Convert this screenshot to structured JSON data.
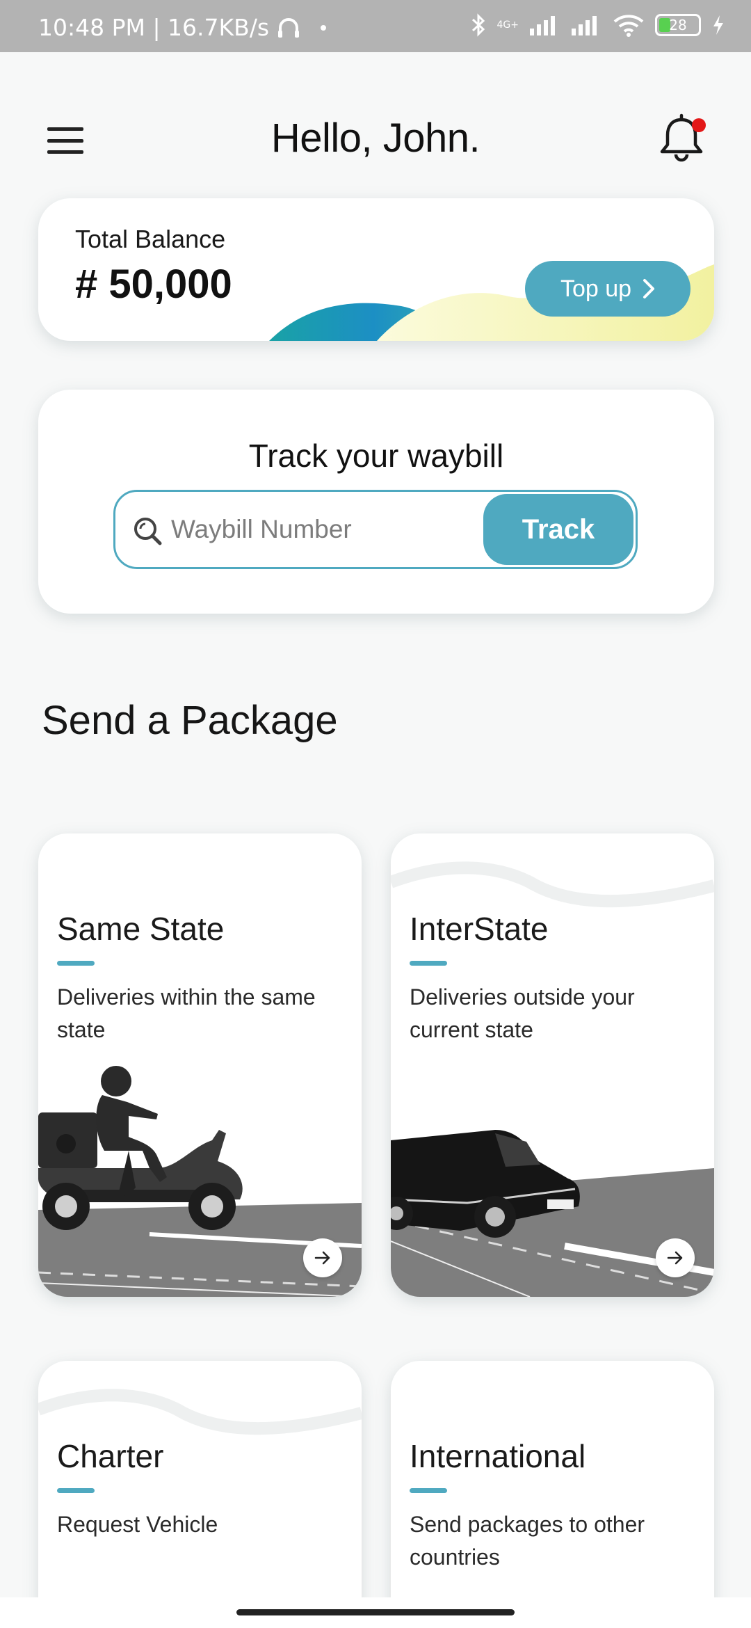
{
  "status_bar": {
    "time_speed": "10:48 PM | 16.7KB/s",
    "battery": "28",
    "network_label": "4G+"
  },
  "header": {
    "greeting": "Hello, John."
  },
  "balance": {
    "label": "Total Balance",
    "value": "# 50,000",
    "topup_label": "Top up"
  },
  "track": {
    "title": "Track your waybill",
    "placeholder": "Waybill Number",
    "button_label": "Track"
  },
  "packages": {
    "section_title": "Send a Package",
    "items": [
      {
        "title": "Same State",
        "description": "Deliveries within the same state"
      },
      {
        "title": "InterState",
        "description": "Deliveries outside your current state"
      },
      {
        "title": "Charter",
        "description": "Request Vehicle"
      },
      {
        "title": "International",
        "description": "Send packages to other countries"
      }
    ]
  },
  "colors": {
    "accent": "#4fa9c0",
    "notification_dot": "#e31818",
    "status_bar": "#b3b3b3"
  }
}
